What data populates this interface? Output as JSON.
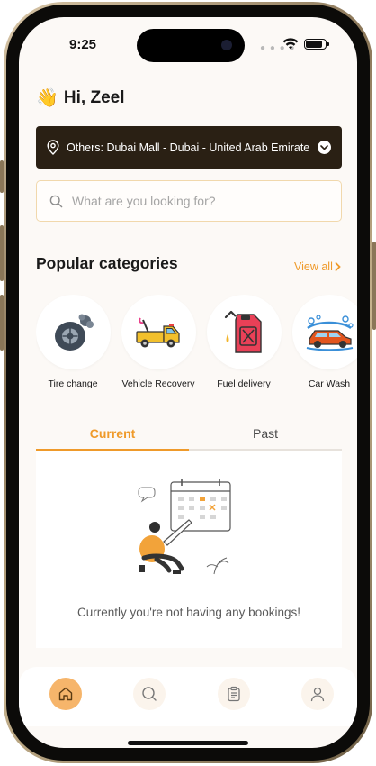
{
  "status_bar": {
    "time": "9:25"
  },
  "greeting": {
    "wave": "👋",
    "text": "Hi, Zeel"
  },
  "location": {
    "text": "Others: Dubai Mall - Dubai - United Arab Emirates"
  },
  "search": {
    "placeholder": "What are you looking for?"
  },
  "categories_section": {
    "title": "Popular categories",
    "view_all": "View all",
    "items": [
      {
        "label": "Tire change",
        "icon": "tire-icon"
      },
      {
        "label": "Vehicle Recovery",
        "icon": "tow-truck-icon"
      },
      {
        "label": "Fuel delivery",
        "icon": "fuel-can-icon"
      },
      {
        "label": "Car Wash",
        "icon": "car-wash-icon"
      }
    ]
  },
  "bookings": {
    "tabs": [
      {
        "label": "Current"
      },
      {
        "label": "Past"
      }
    ],
    "active_tab": "Current",
    "empty_message": "Currently you're not having any bookings!"
  },
  "bottom_nav": {
    "items": [
      {
        "icon": "home-icon"
      },
      {
        "icon": "search-icon"
      },
      {
        "icon": "bookings-clipboard-icon"
      },
      {
        "icon": "profile-icon"
      }
    ],
    "active": "home-icon"
  },
  "colors": {
    "accent": "#ef9a2a",
    "location_bar": "#2a2014",
    "background": "#fcf9f6"
  }
}
